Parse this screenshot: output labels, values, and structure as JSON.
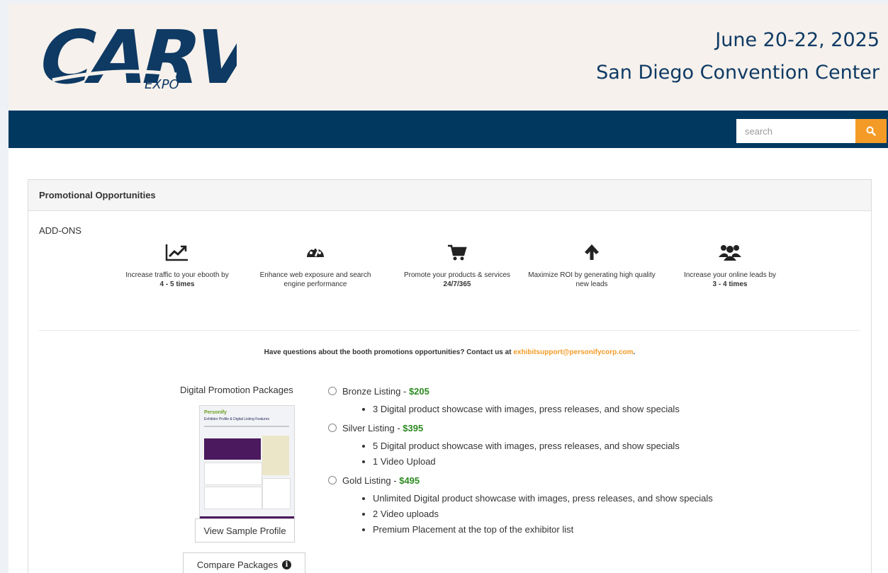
{
  "header": {
    "logo_main": "CARV",
    "logo_sub": "EXPO",
    "event_date": "June 20-22, 2025",
    "event_venue": "San Diego Convention Center"
  },
  "search": {
    "placeholder": "search",
    "button_icon": "search-icon"
  },
  "panel": {
    "title": "Promotional Opportunities",
    "addons_label": "ADD-ONS",
    "features": [
      {
        "icon": "line-chart-icon",
        "text": "Increase traffic to your ebooth by",
        "emph": "4 - 5 times"
      },
      {
        "icon": "tachometer-icon",
        "text": "Enhance web exposure and search engine performance",
        "emph": ""
      },
      {
        "icon": "shopping-cart-icon",
        "text": "Promote your products & services",
        "emph": "24/7/365"
      },
      {
        "icon": "arrow-up-icon",
        "text": "Maximize ROI by generating high quality new leads",
        "emph": ""
      },
      {
        "icon": "users-icon",
        "text": "Increase your online leads by",
        "emph": "3 - 4 times"
      }
    ],
    "contact_text": "Have questions about the booth promotions opportunities? Contact us at",
    "contact_email": "exhibitsupport@personifycorp.com",
    "contact_end": ".",
    "packages_title": "Digital Promotion Packages",
    "sample_brand": "Personify",
    "sample_heading": "Exhibitor Profile & Digital Listing Features",
    "view_sample_label": "View Sample Profile",
    "compare_label": "Compare Packages",
    "packages": [
      {
        "name": "Bronze Listing",
        "sep": " - ",
        "price": "$205",
        "items": [
          "3 Digital product showcase with images, press releases, and show specials"
        ]
      },
      {
        "name": "Silver Listing",
        "sep": " - ",
        "price": "$395",
        "items": [
          "5 Digital product showcase with images, press releases, and show specials",
          "1 Video Upload"
        ]
      },
      {
        "name": "Gold Listing",
        "sep": " - ",
        "price": "$495",
        "items": [
          "Unlimited Digital product showcase with images, press releases, and show specials",
          "2 Video uploads",
          "Premium Placement at the top of the exhibitor list"
        ]
      }
    ]
  },
  "colors": {
    "navy": "#003860",
    "accent": "#f49b27",
    "price_green": "#2e8b22",
    "header_bg": "#f6f1ec"
  }
}
